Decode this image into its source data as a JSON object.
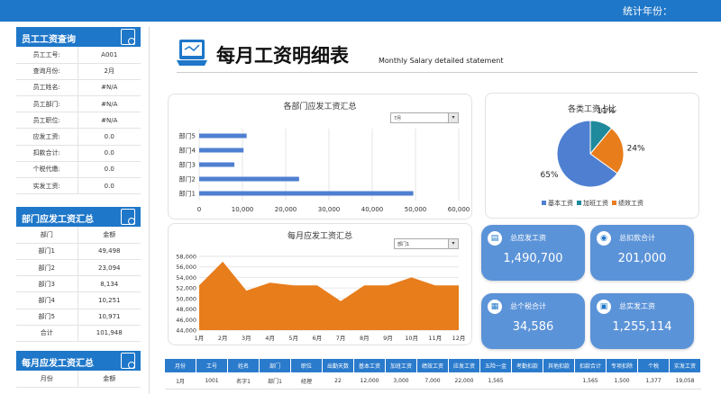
{
  "header": {
    "stat_label": "统计年份："
  },
  "query_panel": {
    "title": "员工工资查询",
    "rows": [
      {
        "label": "员工工号:",
        "value": "A001"
      },
      {
        "label": "查询月份:",
        "value": "2月"
      },
      {
        "label": "员工姓名:",
        "value": "#N/A"
      },
      {
        "label": "员工部门:",
        "value": "#N/A"
      },
      {
        "label": "员工职位:",
        "value": "#N/A"
      },
      {
        "label": "应发工资:",
        "value": "0.0"
      },
      {
        "label": "扣款合计:",
        "value": "0.0"
      },
      {
        "label": "个税代缴:",
        "value": "0.0"
      },
      {
        "label": "实发工资:",
        "value": "0.0"
      }
    ]
  },
  "dept_panel": {
    "title": "部门应发工资汇总",
    "header": [
      "部门",
      "金额"
    ],
    "rows": [
      [
        "部门1",
        "49,498"
      ],
      [
        "部门2",
        "23,094"
      ],
      [
        "部门3",
        "8,134"
      ],
      [
        "部门4",
        "10,251"
      ],
      [
        "部门5",
        "10,971"
      ],
      [
        "合计",
        "101,948"
      ]
    ]
  },
  "month_panel": {
    "title": "每月应发工资汇总",
    "header": [
      "月份",
      "金额"
    ]
  },
  "title": {
    "cn": "每月工资明细表",
    "en": "Monthly Salary detailed statement"
  },
  "dept_chart_dropdown": "7月",
  "monthly_chart_dropdown": "部门1",
  "kpis": {
    "total_gross": {
      "label": "总应发工资",
      "value": "1,490,700"
    },
    "total_deduct": {
      "label": "总扣款合计",
      "value": "201,000"
    },
    "total_tax": {
      "label": "总个税合计",
      "value": "34,586"
    },
    "total_net": {
      "label": "总实发工资",
      "value": "1,255,114"
    }
  },
  "bottom_table": {
    "headers": [
      "月份",
      "工号",
      "姓名",
      "部门",
      "职位",
      "出勤天数",
      "基本工资",
      "加班工资",
      "绩效工资",
      "应发工资",
      "五险一金",
      "考勤扣款",
      "其他扣款",
      "扣款合计",
      "专项扣除",
      "个税",
      "实发工资"
    ],
    "row": [
      "1月",
      "1001",
      "名字1",
      "部门1",
      "经理",
      "22",
      "12,000",
      "3,000",
      "7,000",
      "22,000",
      "1,565",
      "",
      "",
      "1,565",
      "1,500",
      "1,377",
      "19,058"
    ]
  },
  "chart_data": [
    {
      "type": "bar",
      "orientation": "horizontal",
      "title": "各部门应发工资汇总",
      "categories": [
        "部门5",
        "部门4",
        "部门3",
        "部门2",
        "部门1"
      ],
      "values": [
        10971,
        10251,
        8134,
        23094,
        49498
      ],
      "xlim": [
        0,
        60000
      ],
      "xticks": [
        "0",
        "10,000",
        "20,000",
        "30,000",
        "40,000",
        "50,000",
        "60,000"
      ],
      "color": "#4f7fd1",
      "grid": true
    },
    {
      "type": "area",
      "title": "每月应发工资汇总",
      "categories": [
        "1月",
        "2月",
        "3月",
        "4月",
        "5月",
        "6月",
        "7月",
        "8月",
        "9月",
        "10月",
        "11月",
        "12月"
      ],
      "values": [
        52500,
        57000,
        51500,
        53000,
        52500,
        52500,
        49500,
        52500,
        52500,
        54000,
        52500,
        52500
      ],
      "ylim": [
        44000,
        58000
      ],
      "yticks": [
        "44,000",
        "46,000",
        "48,000",
        "50,000",
        "52,000",
        "54,000",
        "56,000",
        "58,000"
      ],
      "color": "#e87d1c",
      "grid": true
    },
    {
      "type": "pie",
      "title": "各类工资占比",
      "labels": [
        "基本工资",
        "加班工资",
        "绩效工资"
      ],
      "values": [
        65,
        11,
        24
      ],
      "value_labels": [
        "65%",
        "11%",
        "24%"
      ],
      "colors": [
        "#4f7fd1",
        "#1f8a9c",
        "#e87d1c"
      ],
      "legend": "bottom"
    }
  ]
}
